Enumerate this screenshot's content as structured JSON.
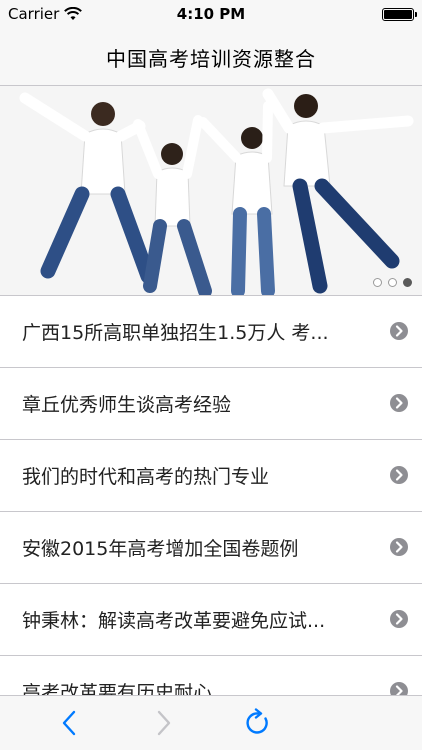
{
  "status_bar": {
    "carrier": "Carrier",
    "time": "4:10 PM"
  },
  "nav": {
    "title": "中国高考培训资源整合"
  },
  "banner": {
    "slides": 3,
    "active_slide": 3
  },
  "list": {
    "items": [
      {
        "label": "广西15所高职单独招生1.5万人 考..."
      },
      {
        "label": "章丘优秀师生谈高考经验"
      },
      {
        "label": "我们的时代和高考的热门专业"
      },
      {
        "label": "安徽2015年高考增加全国卷题例"
      },
      {
        "label": "钟秉林：解读高考改革要避免应试..."
      },
      {
        "label": "高考改革要有历史耐心"
      }
    ]
  },
  "toolbar": {
    "back_icon": "chevron-left-icon",
    "forward_icon": "chevron-right-icon",
    "reload_icon": "reload-icon",
    "accent_color": "#007aff",
    "disabled_color": "#c4c4c8"
  }
}
